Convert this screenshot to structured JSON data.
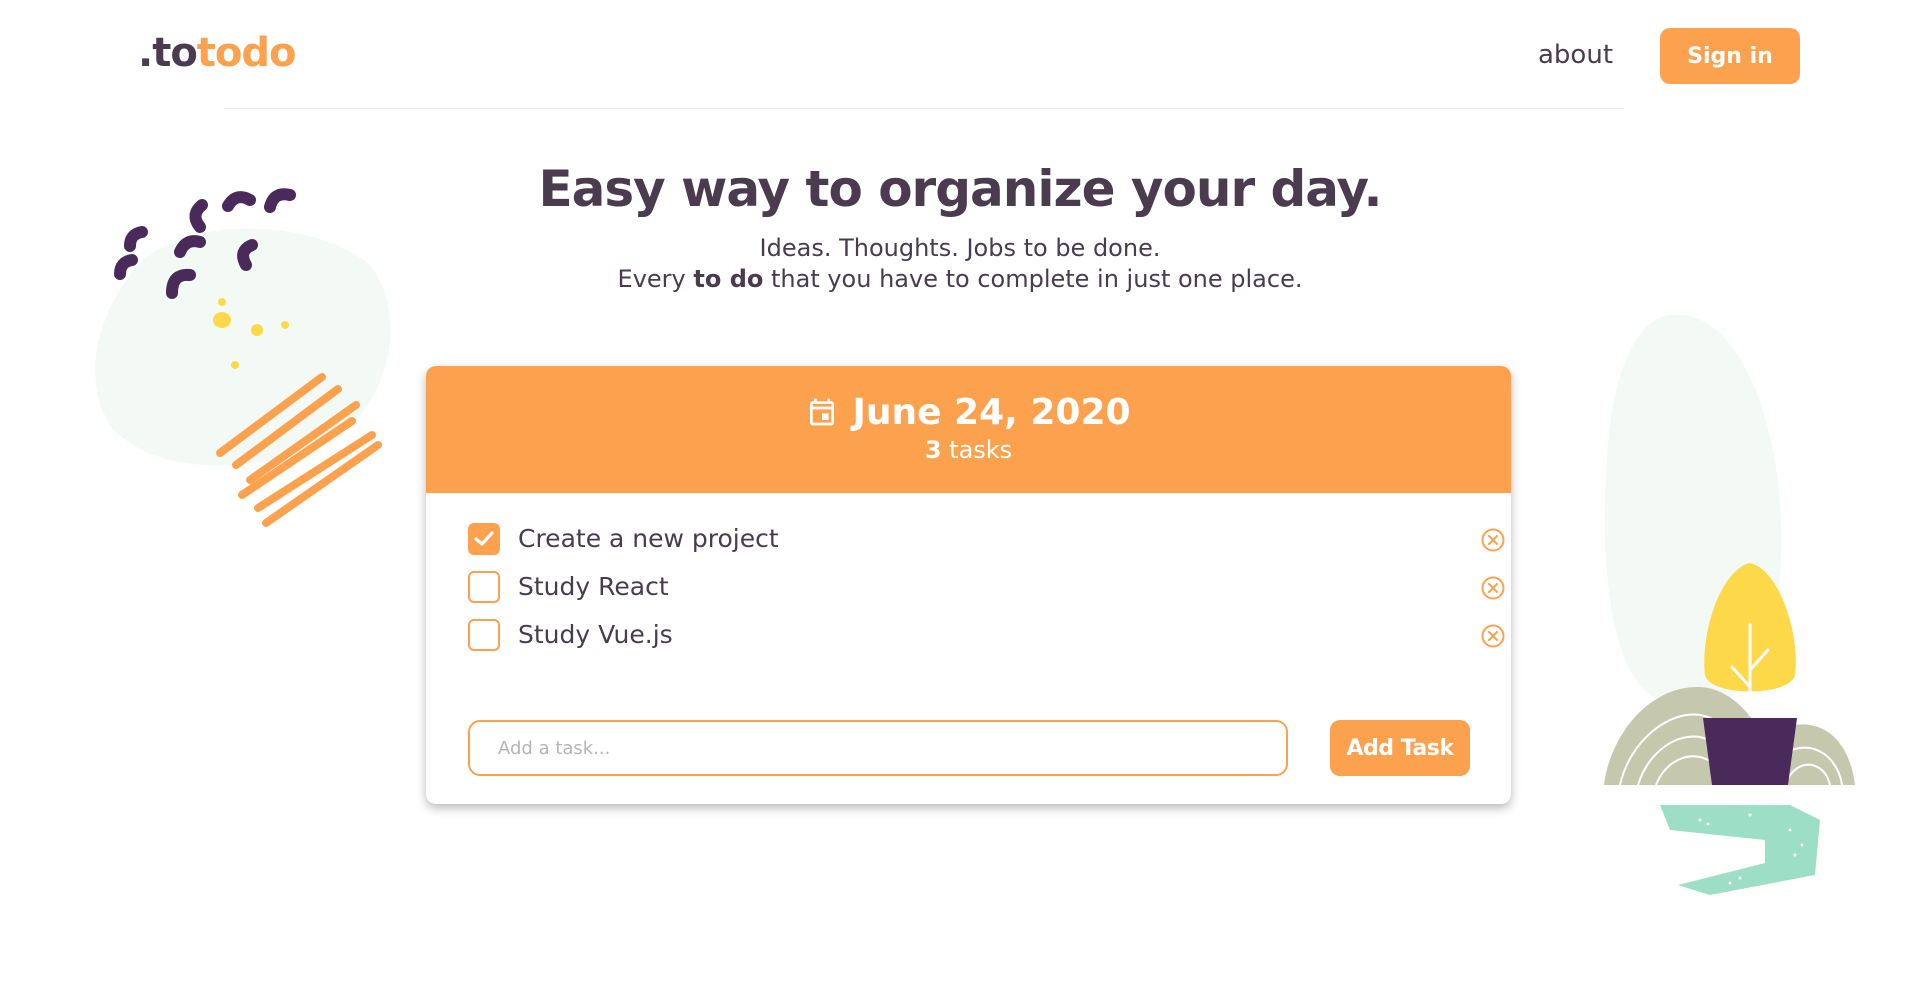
{
  "header": {
    "logo_part1": ".to",
    "logo_part2": "todo",
    "about_label": "about",
    "signin_label": "Sign in"
  },
  "hero": {
    "title": "Easy way to organize your day.",
    "subtitle_line1": "Ideas. Thoughts. Jobs to be done.",
    "subtitle_line2_before": "Every ",
    "subtitle_line2_strong": "to do",
    "subtitle_line2_after": " that you have to complete in just one place."
  },
  "card": {
    "date": "June 24, 2020",
    "task_count": "3",
    "task_count_suffix": "tasks",
    "tasks": [
      {
        "label": "Create a new project",
        "done": true
      },
      {
        "label": "Study React",
        "done": false
      },
      {
        "label": "Study Vue.js",
        "done": false
      }
    ],
    "input_placeholder": "Add a task...",
    "input_value": "",
    "add_button_label": "Add Task"
  },
  "colors": {
    "accent": "#fca24e",
    "text": "#4a3b4f",
    "blob": "#f3f9f5",
    "plant_yellow": "#fdd94a",
    "pot": "#4a2a5a",
    "path": "#9ddfc6",
    "hills": "#c5c8ad"
  },
  "icons": {
    "calendar": "calendar-icon",
    "check": "check-icon",
    "delete": "close-circle-icon"
  }
}
